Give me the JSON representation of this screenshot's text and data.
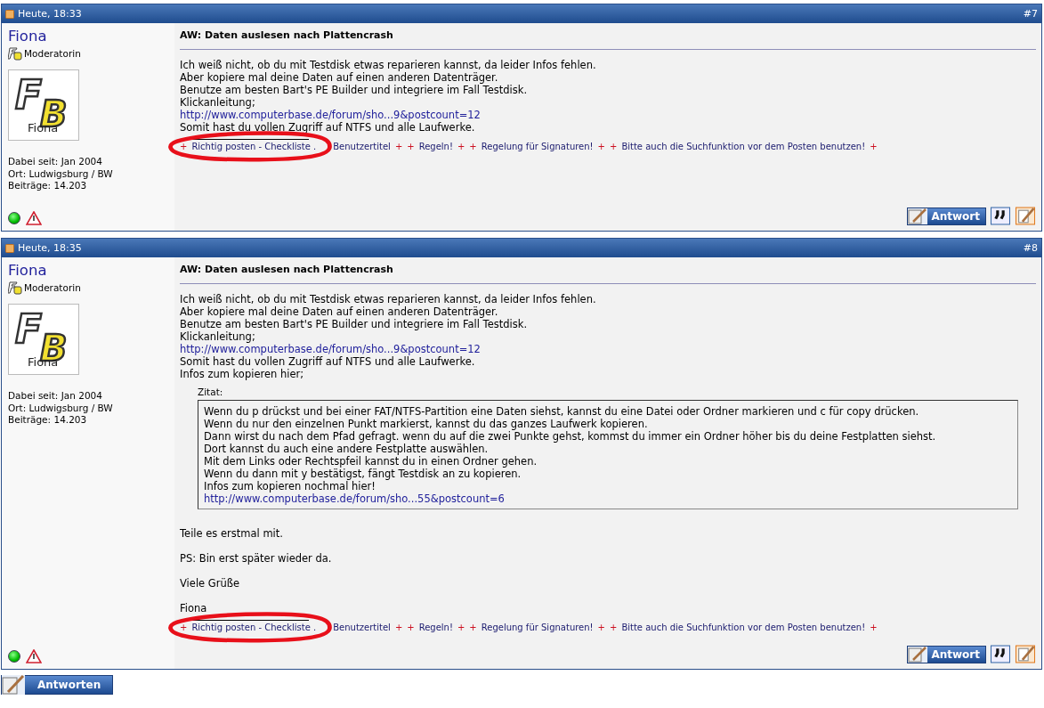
{
  "posts": [
    {
      "date": "Heute, 18:33",
      "number": "#7",
      "author": {
        "name": "Fiona",
        "rank": "Moderatorin",
        "avatar": {
          "letters": [
            "F",
            "B"
          ],
          "caption": "Fiona"
        },
        "stats": [
          "Dabei seit: Jan 2004",
          "Ort: Ludwigsburg / BW",
          "Beiträge: 14.203"
        ],
        "online": true
      },
      "title": "AW: Daten auslesen nach Plattencrash",
      "body": [
        {
          "kind": "text",
          "text": "Ich weiß nicht, ob du mit Testdisk etwas reparieren kannst, da leider Infos fehlen."
        },
        {
          "kind": "text",
          "text": "Aber kopiere mal deine Daten auf einen anderen Datenträger."
        },
        {
          "kind": "text",
          "text": "Benutze am besten Bart's PE Builder und integriere im Fall Testdisk."
        },
        {
          "kind": "text",
          "text": "Klickanleitung;"
        },
        {
          "kind": "link",
          "text": "http://www.computerbase.de/forum/sho...9&postcount=12"
        },
        {
          "kind": "text",
          "text": "Somit hast du vollen Zugriff auf NTFS und alle Laufwerke."
        }
      ],
      "signature": [
        {
          "kind": "plus",
          "text": "+"
        },
        {
          "kind": "link",
          "text": "Richtig posten - Checkliste ."
        },
        {
          "kind": "link",
          "text": "Benutzertitel"
        },
        {
          "kind": "plus",
          "text": "+"
        },
        {
          "kind": "plus",
          "text": "+"
        },
        {
          "kind": "link",
          "text": "Regeln!"
        },
        {
          "kind": "plus",
          "text": "+"
        },
        {
          "kind": "plus",
          "text": "+"
        },
        {
          "kind": "link",
          "text": "Regelung für Signaturen!"
        },
        {
          "kind": "plus",
          "text": "+"
        },
        {
          "kind": "plus",
          "text": "+"
        },
        {
          "kind": "link",
          "text": "Bitte auch die Suchfunktion vor dem Posten benutzen!"
        },
        {
          "kind": "plus",
          "text": "+"
        }
      ],
      "reply": "Antwort"
    },
    {
      "date": "Heute, 18:35",
      "number": "#8",
      "author": {
        "name": "Fiona",
        "rank": "Moderatorin",
        "avatar": {
          "letters": [
            "F",
            "B"
          ],
          "caption": "Fiona"
        },
        "stats": [
          "Dabei seit: Jan 2004",
          "Ort: Ludwigsburg / BW",
          "Beiträge: 14.203"
        ],
        "online": true
      },
      "title": "AW: Daten auslesen nach Plattencrash",
      "body": [
        {
          "kind": "text",
          "text": "Ich weiß nicht, ob du mit Testdisk etwas reparieren kannst, da leider Infos fehlen."
        },
        {
          "kind": "text",
          "text": "Aber kopiere mal deine Daten auf einen anderen Datenträger."
        },
        {
          "kind": "text",
          "text": "Benutze am besten Bart's PE Builder und integriere im Fall Testdisk."
        },
        {
          "kind": "text",
          "text": "Klickanleitung;"
        },
        {
          "kind": "link",
          "text": "http://www.computerbase.de/forum/sho...9&postcount=12"
        },
        {
          "kind": "text",
          "text": "Somit hast du vollen Zugriff auf NTFS und alle Laufwerke."
        },
        {
          "kind": "text",
          "text": "Infos zum kopieren hier;"
        }
      ],
      "quote": {
        "label": "Zitat:",
        "lines": [
          {
            "kind": "text",
            "text": "Wenn du p drückst und bei einer FAT/NTFS-Partition eine Daten siehst, kannst du eine Datei oder Ordner markieren und c für copy drücken."
          },
          {
            "kind": "text",
            "text": "Wenn du nur den einzelnen Punkt markierst, kannst du das ganzes Laufwerk kopieren."
          },
          {
            "kind": "text",
            "text": "Dann wirst du nach dem Pfad gefragt. wenn du auf die zwei Punkte gehst, kommst du immer ein Ordner höher bis du deine Festplatten siehst."
          },
          {
            "kind": "text",
            "text": "Dort kannst du auch eine andere Festplatte auswählen."
          },
          {
            "kind": "text",
            "text": "Mit dem Links oder Rechtspfeil kannst du in einen Ordner gehen."
          },
          {
            "kind": "text",
            "text": "Wenn du dann mit y bestätigst, fängt Testdisk an zu kopieren."
          },
          {
            "kind": "text",
            "text": "Infos zum kopieren nochmal hier!"
          },
          {
            "kind": "link",
            "text": "http://www.computerbase.de/forum/sho...55&postcount=6"
          }
        ]
      },
      "after": [
        "Teile es erstmal mit.",
        "PS: Bin erst später wieder da.",
        "Viele Grüße",
        "Fiona"
      ],
      "signature": [
        {
          "kind": "plus",
          "text": "+"
        },
        {
          "kind": "link",
          "text": "Richtig posten - Checkliste ."
        },
        {
          "kind": "link",
          "text": "Benutzertitel"
        },
        {
          "kind": "plus",
          "text": "+"
        },
        {
          "kind": "plus",
          "text": "+"
        },
        {
          "kind": "link",
          "text": "Regeln!"
        },
        {
          "kind": "plus",
          "text": "+"
        },
        {
          "kind": "plus",
          "text": "+"
        },
        {
          "kind": "link",
          "text": "Regelung für Signaturen!"
        },
        {
          "kind": "plus",
          "text": "+"
        },
        {
          "kind": "plus",
          "text": "+"
        },
        {
          "kind": "link",
          "text": "Bitte auch die Suchfunktion vor dem Posten benutzen!"
        },
        {
          "kind": "plus",
          "text": "+"
        }
      ],
      "reply": "Antwort"
    }
  ],
  "reply_button": "Antworten"
}
